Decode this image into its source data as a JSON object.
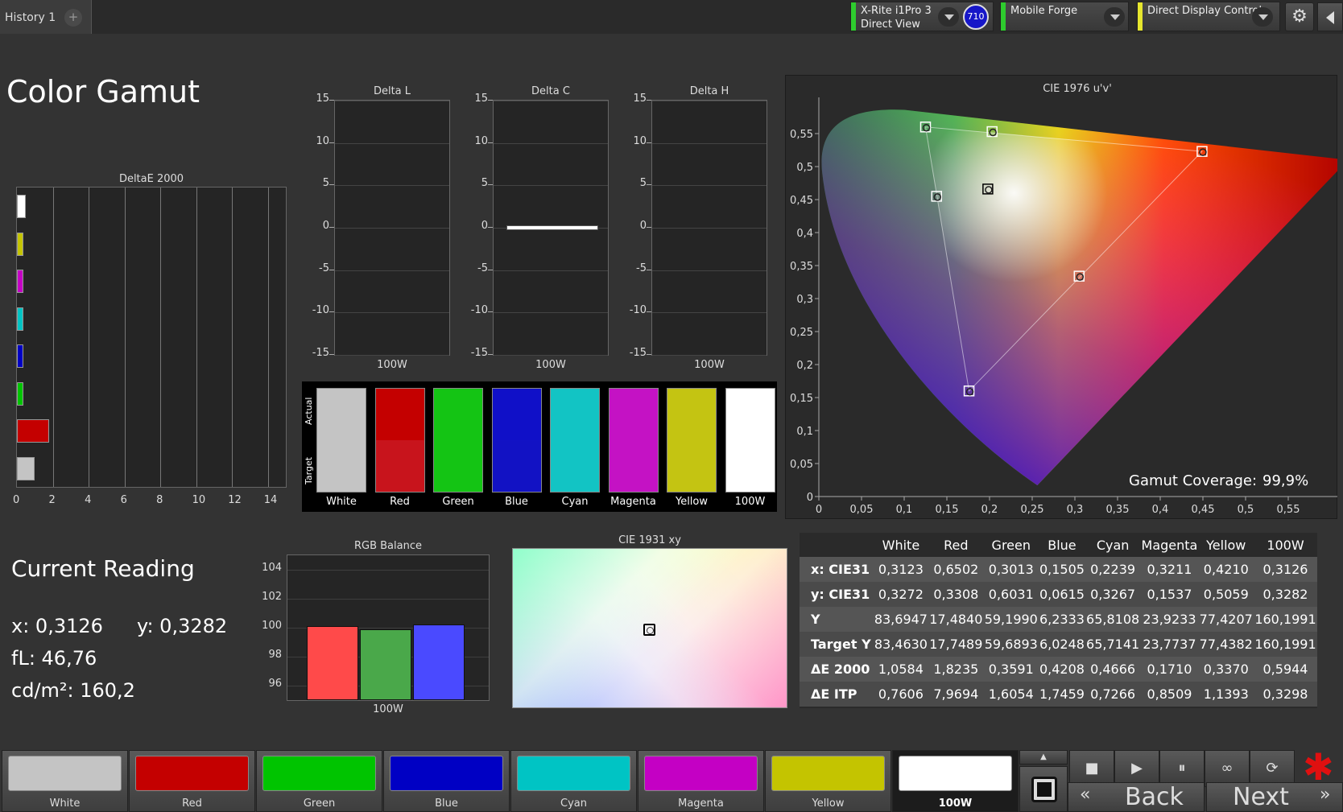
{
  "tabs": {
    "history": "History 1",
    "add": "+"
  },
  "devices": [
    {
      "line1": "X-Rite i1Pro 3",
      "line2": "Direct View",
      "color": "#2ecc2e"
    },
    {
      "line1": "Mobile Forge",
      "line2": "",
      "color": "#2ecc2e"
    },
    {
      "line1": "Direct Display Control",
      "line2": "",
      "color": "#e6e62e"
    }
  ],
  "badge": "710",
  "page_title": "Color Gamut",
  "deltae": {
    "title": "DeltaE 2000",
    "ticks": [
      "0",
      "2",
      "4",
      "6",
      "8",
      "10",
      "12",
      "14"
    ]
  },
  "delta_charts": [
    {
      "title": "Delta L",
      "xlabel": "100W"
    },
    {
      "title": "Delta C",
      "xlabel": "100W"
    },
    {
      "title": "Delta H",
      "xlabel": "100W"
    }
  ],
  "delta_ticks": [
    "15",
    "10",
    "5",
    "0",
    "-5",
    "-10",
    "-15"
  ],
  "swatches": {
    "actual_label": "Actual",
    "target_label": "Target",
    "items": [
      {
        "name": "White",
        "actual": "#c4c4c4",
        "target": "#c4c4c4"
      },
      {
        "name": "Red",
        "actual": "#c40000",
        "target": "#c8141c"
      },
      {
        "name": "Green",
        "actual": "#14c414",
        "target": "#14c414"
      },
      {
        "name": "Blue",
        "actual": "#1010c8",
        "target": "#1212c4"
      },
      {
        "name": "Cyan",
        "actual": "#12c4c4",
        "target": "#12c4c4"
      },
      {
        "name": "Magenta",
        "actual": "#c412c4",
        "target": "#c412c4"
      },
      {
        "name": "Yellow",
        "actual": "#c4c412",
        "target": "#c4c412"
      },
      {
        "name": "100W",
        "actual": "#ffffff",
        "target": "#ffffff"
      }
    ]
  },
  "cie1976": {
    "title": "CIE 1976 u'v'",
    "yticks": [
      "0,55",
      "0,5",
      "0,45",
      "0,4",
      "0,35",
      "0,3",
      "0,25",
      "0,2",
      "0,15",
      "0,1",
      "0,05",
      "0"
    ],
    "xticks": [
      "0",
      "0,05",
      "0,1",
      "0,15",
      "0,2",
      "0,25",
      "0,3",
      "0,35",
      "0,4",
      "0,45",
      "0,5",
      "0,55"
    ],
    "coverage_label": "Gamut Coverage:",
    "coverage_value": "99,9%"
  },
  "current": {
    "title": "Current Reading",
    "x": "x: 0,3126",
    "y": "y: 0,3282",
    "fl": "fL: 46,76",
    "cd": "cd/m²: 160,2"
  },
  "rgb_balance": {
    "title": "RGB Balance",
    "yticks": [
      "104",
      "102",
      "100",
      "98",
      "96"
    ],
    "xlabel": "100W"
  },
  "cie1931": {
    "title": "CIE 1931 xy"
  },
  "table": {
    "headers": [
      "",
      "White",
      "Red",
      "Green",
      "Blue",
      "Cyan",
      "Magenta",
      "Yellow",
      "100W"
    ],
    "rows": [
      [
        "x: CIE31",
        "0,3123",
        "0,6502",
        "0,3013",
        "0,1505",
        "0,2239",
        "0,3211",
        "0,4210",
        "0,3126"
      ],
      [
        "y: CIE31",
        "0,3272",
        "0,3308",
        "0,6031",
        "0,0615",
        "0,3267",
        "0,1537",
        "0,5059",
        "0,3282"
      ],
      [
        "Y",
        "83,6947",
        "17,4840",
        "59,1990",
        "6,2333",
        "65,8108",
        "23,9233",
        "77,4207",
        "160,1991"
      ],
      [
        "Target Y",
        "83,4630",
        "17,7489",
        "59,6893",
        "6,0248",
        "65,7141",
        "23,7737",
        "77,4382",
        "160,1991"
      ],
      [
        "ΔE 2000",
        "1,0584",
        "1,8235",
        "0,3591",
        "0,4208",
        "0,4666",
        "0,1710",
        "0,3370",
        "0,5944"
      ],
      [
        "ΔE ITP",
        "0,7606",
        "7,9694",
        "1,6054",
        "1,7459",
        "0,7266",
        "0,8509",
        "1,1393",
        "0,3298"
      ]
    ]
  },
  "bottom_swatches": [
    {
      "label": "White",
      "color": "#c4c4c4"
    },
    {
      "label": "Red",
      "color": "#c40000"
    },
    {
      "label": "Green",
      "color": "#00c400"
    },
    {
      "label": "Blue",
      "color": "#0000c4"
    },
    {
      "label": "Cyan",
      "color": "#00c4c4"
    },
    {
      "label": "Magenta",
      "color": "#c400c4"
    },
    {
      "label": "Yellow",
      "color": "#c4c400"
    },
    {
      "label": "100W",
      "color": "#ffffff"
    }
  ],
  "nav": {
    "back": "Back",
    "next": "Next"
  },
  "chart_data": [
    {
      "type": "bar",
      "title": "DeltaE 2000",
      "categories": [
        "White",
        "Yellow",
        "Magenta",
        "Cyan",
        "Blue",
        "Green",
        "Red",
        "100W"
      ],
      "values": [
        0.5,
        0.3,
        0.1,
        0.35,
        0.3,
        0.25,
        1.8,
        1.0
      ],
      "colors": [
        "#ffffff",
        "#c4c400",
        "#c400c4",
        "#00c4c4",
        "#0000c4",
        "#00c400",
        "#c40000",
        "#c4c4c4"
      ],
      "xlim": [
        0,
        15
      ],
      "orientation": "horizontal"
    },
    {
      "type": "bar",
      "title": "RGB Balance",
      "categories": [
        "100W"
      ],
      "series": [
        {
          "values": [
            100.1
          ],
          "color": "#ff4a4a"
        },
        {
          "values": [
            99.9
          ],
          "color": "#4aa84a"
        },
        {
          "values": [
            100.2
          ],
          "color": "#4a4aff"
        }
      ],
      "ylim": [
        95,
        105
      ]
    },
    {
      "type": "scatter",
      "title": "CIE 1976 u'v'",
      "xlim": [
        0,
        0.6
      ],
      "ylim": [
        0,
        0.6
      ],
      "points": [
        {
          "name": "White",
          "u": 0.198,
          "v": 0.466
        },
        {
          "name": "Red",
          "u": 0.449,
          "v": 0.523
        },
        {
          "name": "Green",
          "u": 0.125,
          "v": 0.56
        },
        {
          "name": "Blue",
          "u": 0.176,
          "v": 0.16
        },
        {
          "name": "Cyan",
          "u": 0.138,
          "v": 0.455
        },
        {
          "name": "Magenta",
          "u": 0.305,
          "v": 0.334
        },
        {
          "name": "Yellow",
          "u": 0.203,
          "v": 0.553
        }
      ]
    }
  ]
}
